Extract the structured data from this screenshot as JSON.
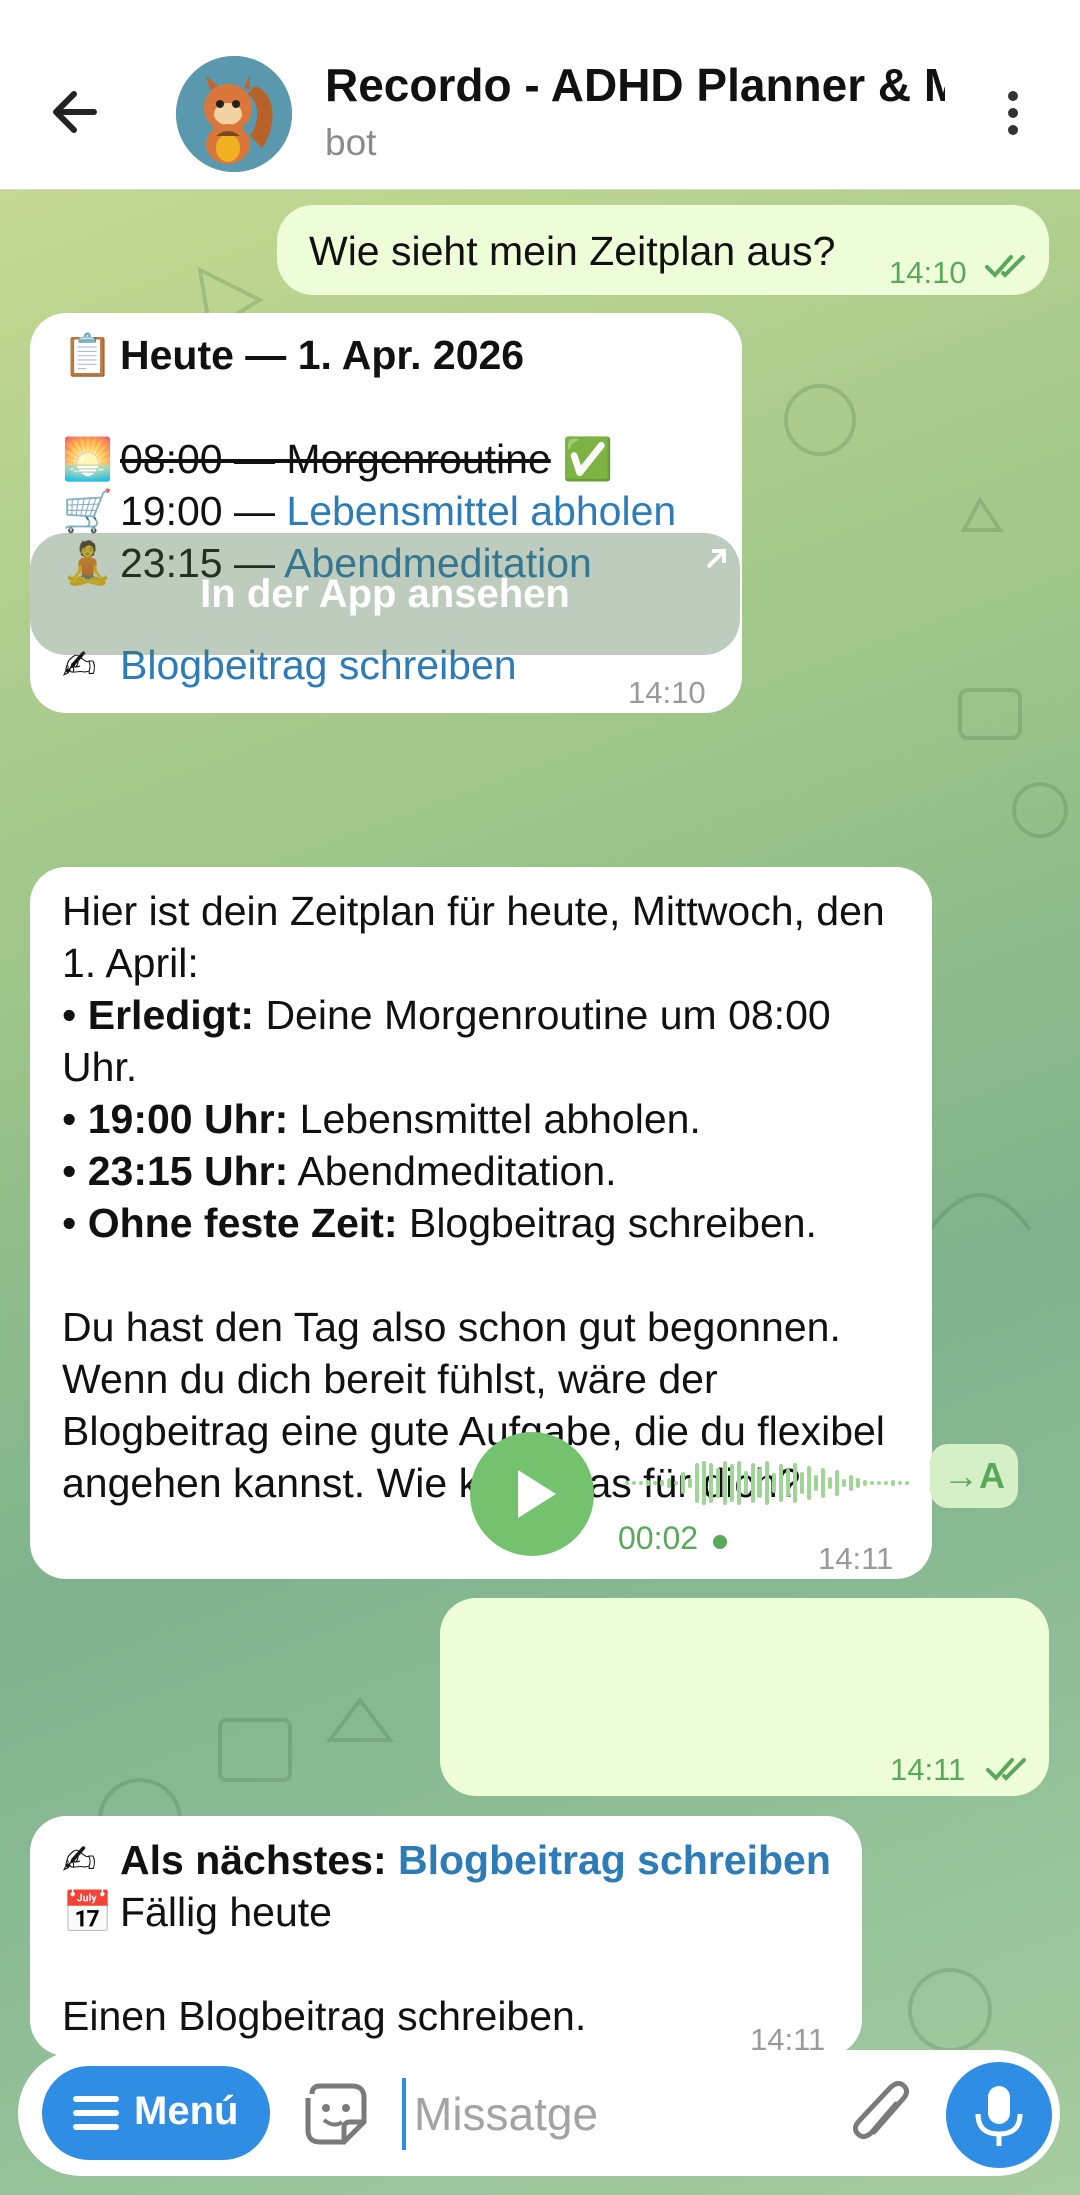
{
  "header": {
    "title": "Recordo - ADHD Planner & M",
    "subtitle": "bot"
  },
  "messages": {
    "m1": {
      "text": "Wie sieht mein Zeitplan aus?",
      "time": "14:10"
    },
    "m2": {
      "title": "Heute — 1. Apr. 2026",
      "line1_icon": "sunrise-icon",
      "line1": "08:00 — Morgenroutine",
      "line1_done_icon": "checkmark-icon",
      "line2_icon": "shopping-cart-icon",
      "line2_prefix": "19:00 — ",
      "line2_link": "Lebensmittel abholen",
      "line3_icon": "meditation-icon",
      "line3_prefix": "23:15 — ",
      "line3_link": "Abendmeditation",
      "line4_icon": "writing-hand-icon",
      "line4_link": "Blogbeitrag schreiben",
      "time": "14:10"
    },
    "app_button": "In der App ansehen",
    "m3": {
      "intro": "Hier ist dein Zeitplan für heute, Mittwoch, den 1. April:",
      "b1_bold": "Erledigt:",
      "b1": " Deine Morgenroutine um 08:00 Uhr.",
      "b2_bold": "19:00 Uhr:",
      "b2": " Lebensmittel abholen.",
      "b3_bold": "23:15 Uhr:",
      "b3": " Abendmeditation.",
      "b4_bold": "Ohne feste Zeit:",
      "b4": " Blogbeitrag schreiben.",
      "outro": "Du hast den Tag also schon gut begonnen. Wenn du dich bereit fühlst, wäre der Blogbeitrag eine gute Aufgabe, die du flexibel angehen kannst. Wie klingt das für dich?",
      "time": "14:11"
    },
    "voice": {
      "duration": "00:02",
      "transcribe": "→A",
      "time": "14:11"
    },
    "m5": {
      "icon1": "writing-hand-icon",
      "label1": "Als nächstes: ",
      "link1": "Blogbeitrag schreiben",
      "icon2": "calendar-icon",
      "line2": "Fällig heute",
      "line3": "Einen Blogbeitrag schreiben.",
      "time": "14:11"
    }
  },
  "composer": {
    "menu_label": "Menú",
    "placeholder": "Missatge"
  },
  "colors": {
    "accent": "#2f8de4",
    "link": "#2d7cb8",
    "outgoing_bubble": "#eefed9",
    "voice_green": "#74c26d"
  }
}
